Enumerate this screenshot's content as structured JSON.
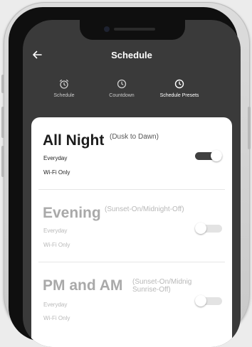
{
  "header": {
    "title": "Schedule",
    "back_icon": "arrow-left-icon"
  },
  "tabs": [
    {
      "label": "Schedule",
      "icon": "alarm-clock-icon",
      "active": false
    },
    {
      "label": "Countdown",
      "icon": "clock-icon",
      "active": false
    },
    {
      "label": "Schedule Presets",
      "icon": "clock-icon",
      "active": true
    }
  ],
  "presets": [
    {
      "name": "All Night",
      "description": "(Dusk to Dawn)",
      "days": "Everyday",
      "mode": "Wi-Fi Only",
      "enabled": true
    },
    {
      "name": "Evening",
      "description": "(Sunset-On/Midnight-Off)",
      "days": "Everyday",
      "mode": "Wi-Fi Only",
      "enabled": false
    },
    {
      "name": "PM and AM",
      "description_line1": "(Sunset-On/Midnig",
      "description_line2": "Sunrise-Off)",
      "days": "Everyday",
      "mode": "Wi-Fi Only",
      "enabled": false
    }
  ],
  "colors": {
    "header_bg": "#3a3a3a",
    "card_bg": "#ffffff",
    "toggle_on": "#404040",
    "toggle_off": "#e3e3e3"
  }
}
